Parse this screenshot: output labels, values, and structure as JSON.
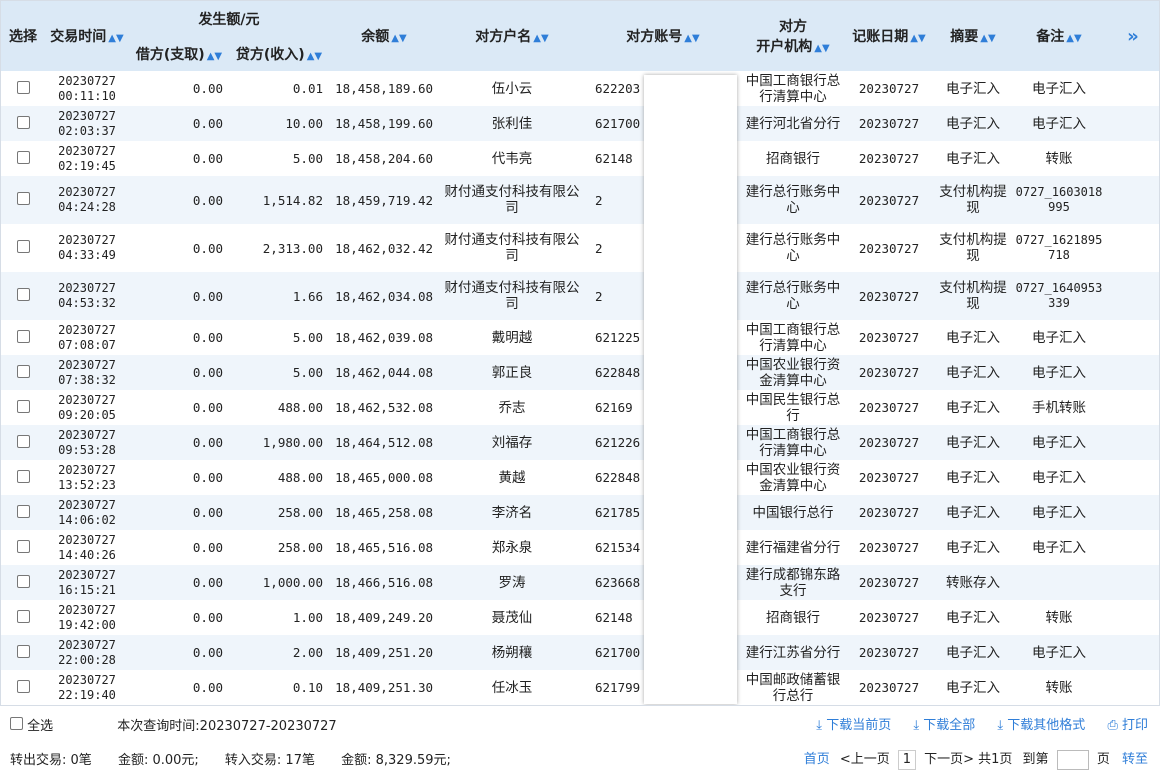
{
  "header": {
    "select": "选择",
    "time": "交易时间",
    "amount_group": "发生额/元",
    "debit": "借方(支取)",
    "credit": "贷方(收入)",
    "balance": "余额",
    "cp_name": "对方户名",
    "cp_account": "对方账号",
    "cp_bank_1": "对方",
    "cp_bank_2": "开户机构",
    "post_date": "记账日期",
    "summary": "摘要",
    "remark": "备注",
    "more": "»"
  },
  "rows": [
    {
      "date": "20230727",
      "time": "00:11:10",
      "debit": "0.00",
      "credit": "0.01",
      "balance": "18,458,189.60",
      "name": "伍小云",
      "acct": "622203",
      "bank": "中国工商银行总行清算中心",
      "post": "20230727",
      "summary": "电子汇入",
      "remark": "电子汇入"
    },
    {
      "date": "20230727",
      "time": "02:03:37",
      "debit": "0.00",
      "credit": "10.00",
      "balance": "18,458,199.60",
      "name": "张利佳",
      "acct": "621700",
      "bank": "建行河北省分行",
      "post": "20230727",
      "summary": "电子汇入",
      "remark": "电子汇入"
    },
    {
      "date": "20230727",
      "time": "02:19:45",
      "debit": "0.00",
      "credit": "5.00",
      "balance": "18,458,204.60",
      "name": "代韦亮",
      "acct": "62148",
      "bank": "招商银行",
      "post": "20230727",
      "summary": "电子汇入",
      "remark": "转账"
    },
    {
      "date": "20230727",
      "time": "04:24:28",
      "debit": "0.00",
      "credit": "1,514.82",
      "balance": "18,459,719.42",
      "name": "财付通支付科技有限公司",
      "acct": "2",
      "bank": "建行总行账务中心",
      "post": "20230727",
      "summary": "支付机构提现",
      "remark": "0727_1603018995"
    },
    {
      "date": "20230727",
      "time": "04:33:49",
      "debit": "0.00",
      "credit": "2,313.00",
      "balance": "18,462,032.42",
      "name": "财付通支付科技有限公司",
      "acct": "2",
      "bank": "建行总行账务中心",
      "post": "20230727",
      "summary": "支付机构提现",
      "remark": "0727_1621895718"
    },
    {
      "date": "20230727",
      "time": "04:53:32",
      "debit": "0.00",
      "credit": "1.66",
      "balance": "18,462,034.08",
      "name": "财付通支付科技有限公司",
      "acct": "2",
      "bank": "建行总行账务中心",
      "post": "20230727",
      "summary": "支付机构提现",
      "remark": "0727_1640953339"
    },
    {
      "date": "20230727",
      "time": "07:08:07",
      "debit": "0.00",
      "credit": "5.00",
      "balance": "18,462,039.08",
      "name": "戴明越",
      "acct": "621225",
      "bank": "中国工商银行总行清算中心",
      "post": "20230727",
      "summary": "电子汇入",
      "remark": "电子汇入"
    },
    {
      "date": "20230727",
      "time": "07:38:32",
      "debit": "0.00",
      "credit": "5.00",
      "balance": "18,462,044.08",
      "name": "郭正良",
      "acct": "622848",
      "bank": "中国农业银行资金清算中心",
      "post": "20230727",
      "summary": "电子汇入",
      "remark": "电子汇入"
    },
    {
      "date": "20230727",
      "time": "09:20:05",
      "debit": "0.00",
      "credit": "488.00",
      "balance": "18,462,532.08",
      "name": "乔志",
      "acct": "62169",
      "bank": "中国民生银行总行",
      "post": "20230727",
      "summary": "电子汇入",
      "remark": "手机转账"
    },
    {
      "date": "20230727",
      "time": "09:53:28",
      "debit": "0.00",
      "credit": "1,980.00",
      "balance": "18,464,512.08",
      "name": "刘福存",
      "acct": "621226",
      "bank": "中国工商银行总行清算中心",
      "post": "20230727",
      "summary": "电子汇入",
      "remark": "电子汇入"
    },
    {
      "date": "20230727",
      "time": "13:52:23",
      "debit": "0.00",
      "credit": "488.00",
      "balance": "18,465,000.08",
      "name": "黄越",
      "acct": "622848",
      "bank": "中国农业银行资金清算中心",
      "post": "20230727",
      "summary": "电子汇入",
      "remark": "电子汇入"
    },
    {
      "date": "20230727",
      "time": "14:06:02",
      "debit": "0.00",
      "credit": "258.00",
      "balance": "18,465,258.08",
      "name": "李济名",
      "acct": "621785",
      "bank": "中国银行总行",
      "post": "20230727",
      "summary": "电子汇入",
      "remark": "电子汇入"
    },
    {
      "date": "20230727",
      "time": "14:40:26",
      "debit": "0.00",
      "credit": "258.00",
      "balance": "18,465,516.08",
      "name": "郑永泉",
      "acct": "621534",
      "bank": "建行福建省分行",
      "post": "20230727",
      "summary": "电子汇入",
      "remark": "电子汇入"
    },
    {
      "date": "20230727",
      "time": "16:15:21",
      "debit": "0.00",
      "credit": "1,000.00",
      "balance": "18,466,516.08",
      "name": "罗涛",
      "acct": "623668",
      "bank": "建行成都锦东路支行",
      "post": "20230727",
      "summary": "转账存入",
      "remark": ""
    },
    {
      "date": "20230727",
      "time": "19:42:00",
      "debit": "0.00",
      "credit": "1.00",
      "balance": "18,409,249.20",
      "name": "聂茂仙",
      "acct": "62148",
      "bank": "招商银行",
      "post": "20230727",
      "summary": "电子汇入",
      "remark": "转账"
    },
    {
      "date": "20230727",
      "time": "22:00:28",
      "debit": "0.00",
      "credit": "2.00",
      "balance": "18,409,251.20",
      "name": "杨朔穰",
      "acct": "621700",
      "bank": "建行江苏省分行",
      "post": "20230727",
      "summary": "电子汇入",
      "remark": "电子汇入"
    },
    {
      "date": "20230727",
      "time": "22:19:40",
      "debit": "0.00",
      "credit": "0.10",
      "balance": "18,409,251.30",
      "name": "任冰玉",
      "acct": "621799",
      "bank": "中国邮政储蓄银行总行",
      "post": "20230727",
      "summary": "电子汇入",
      "remark": "转账"
    }
  ],
  "footer": {
    "select_all": "全选",
    "query_time": "本次查询时间:20230727-20230727",
    "download_current": "下载当前页",
    "download_all": "下载全部",
    "download_other": "下载其他格式",
    "print": "打印",
    "out_count": "转出交易: 0笔",
    "out_amount": "金额: 0.00元;",
    "in_count": "转入交易: 17笔",
    "in_amount": "金额: 8,329.59元;",
    "first": "首页",
    "prev": "<上一页",
    "page": "1",
    "next": "下一页>",
    "total": "共1页",
    "goto": "到第",
    "page_unit": "页",
    "jump": "转至"
  }
}
